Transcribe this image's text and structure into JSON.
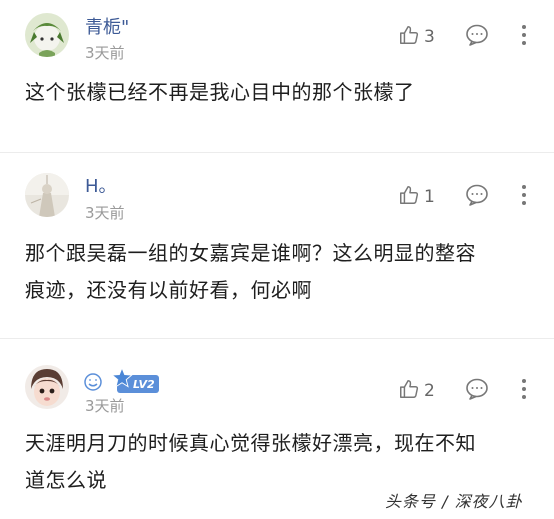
{
  "comments": [
    {
      "username": "青栀\"",
      "time": "3天前",
      "likes": "3",
      "text": "这个张檬已经不再是我心目中的那个张檬了"
    },
    {
      "username": "H。",
      "time": "3天前",
      "likes": "1",
      "text_line1": "那个跟吴磊一组的女嘉宾是谁啊？这么明显的整容",
      "text_line2": "痕迹，还没有以前好看，何必啊"
    },
    {
      "username": "",
      "badge_level": "LV2",
      "time": "3天前",
      "likes": "2",
      "text_line1": "天涯明月刀的时候真心觉得张檬好漂亮，现在不知",
      "text_line2": "道怎么说"
    }
  ],
  "watermark": "头条号 / 深夜八卦",
  "colors": {
    "username": "#3d5a96",
    "timestamp": "#9a9a9a",
    "badge": "#5b8fd9",
    "divider": "#ececec"
  },
  "icons": [
    "thumbs-up-icon",
    "comment-bubble-icon",
    "more-vertical-icon",
    "smile-icon",
    "vip-star-icon"
  ]
}
